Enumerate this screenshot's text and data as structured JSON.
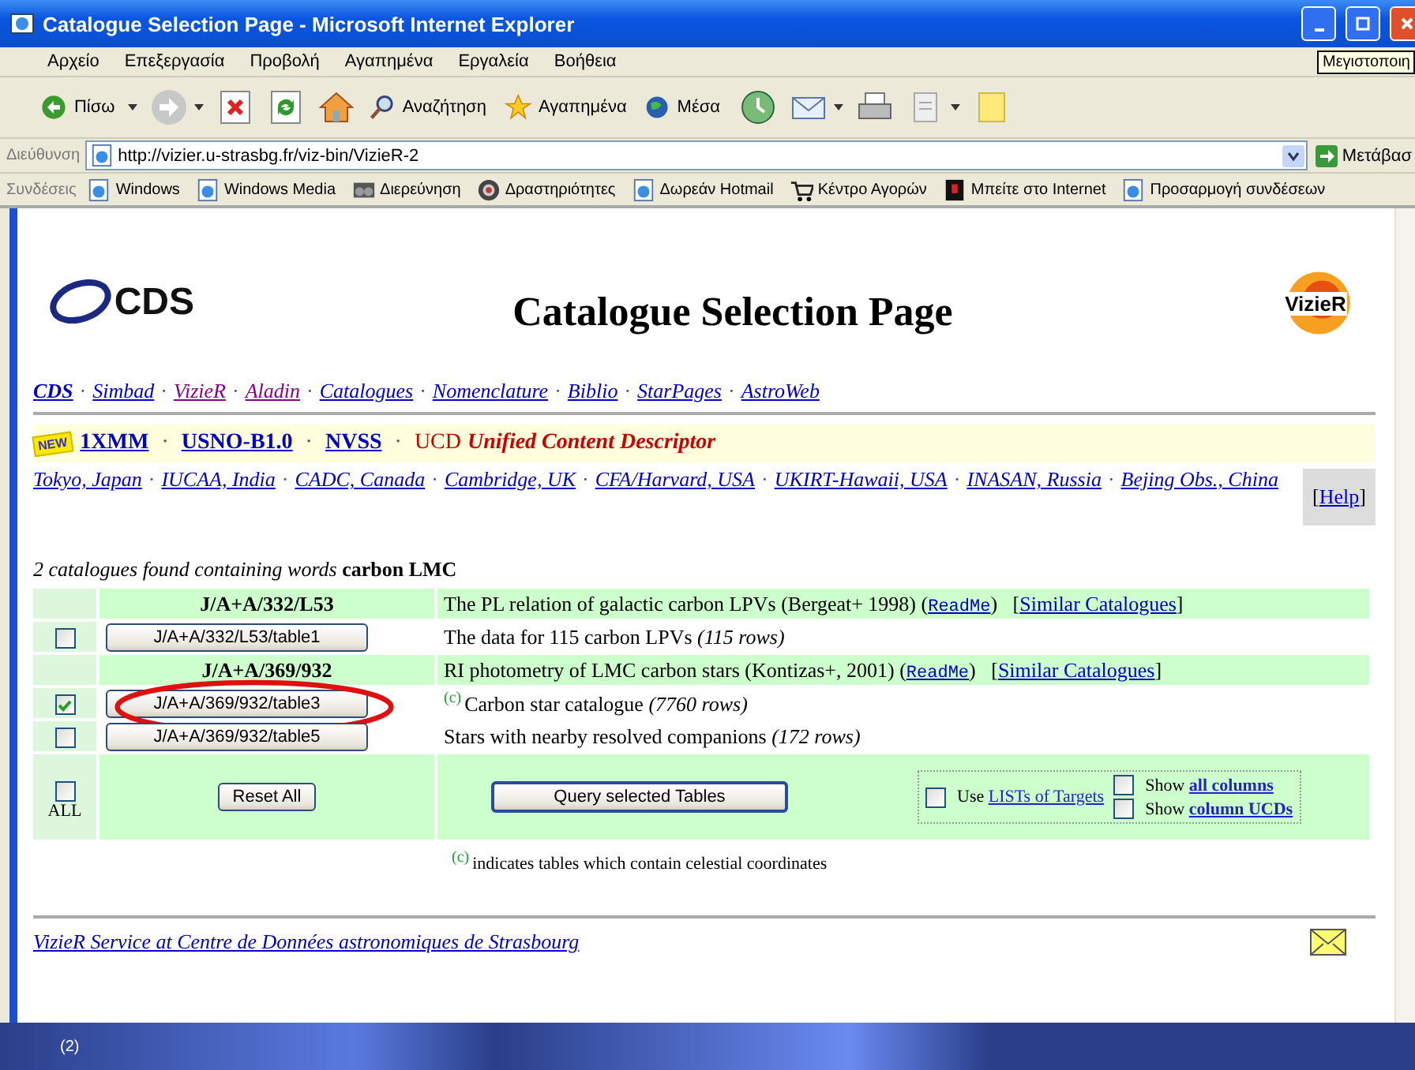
{
  "window": {
    "title": "Catalogue Selection Page - Microsoft Internet Explorer"
  },
  "menu": [
    "Αρχείο",
    "Επεξεργασία",
    "Προβολή",
    "Αγαπημένα",
    "Εργαλεία",
    "Βοήθεια"
  ],
  "tooltip": "Μεγιστοποιη",
  "toolbar": [
    {
      "kind": "back",
      "label": "Πίσω",
      "dropdown": true
    },
    {
      "kind": "forward",
      "dropdown": true
    },
    {
      "kind": "stop",
      "dropdown": false
    },
    {
      "kind": "refresh",
      "dropdown": false
    },
    {
      "kind": "home",
      "dropdown": false
    },
    {
      "kind": "search",
      "label": "Αναζήτηση",
      "dropdown": false
    },
    {
      "kind": "favorites",
      "label": "Αγαπημένα",
      "dropdown": false
    },
    {
      "kind": "media",
      "label": "Μέσα",
      "dropdown": false
    },
    {
      "kind": "history",
      "dropdown": false
    },
    {
      "kind": "mail",
      "dropdown": true
    },
    {
      "kind": "print",
      "dropdown": false
    },
    {
      "kind": "edit",
      "dropdown": true
    },
    {
      "kind": "notes",
      "dropdown": false
    }
  ],
  "address": {
    "label": "Διεύθυνση",
    "value": "http://vizier.u-strasbg.fr/viz-bin/VizieR-2",
    "go": "Μετάβασ"
  },
  "links": {
    "label": "Συνδέσεις",
    "items": [
      {
        "kind": "page",
        "text": "Windows"
      },
      {
        "kind": "page",
        "text": "Windows Media"
      },
      {
        "kind": "explore",
        "text": "Διερεύνηση"
      },
      {
        "kind": "target",
        "text": "Δραστηριότητες"
      },
      {
        "kind": "page",
        "text": "Δωρεάν Hotmail"
      },
      {
        "kind": "cart",
        "text": "Κέντρο Αγορών"
      },
      {
        "kind": "flag",
        "text": "Μπείτε στο Internet"
      },
      {
        "kind": "page",
        "text": "Προσαρμογή συνδέσεων"
      }
    ]
  },
  "page": {
    "cds_logo": "CDS",
    "vizier_logo": "VizieR",
    "title": "Catalogue Selection Page",
    "separator": "·",
    "nav": [
      {
        "text": "CDS",
        "visited": false,
        "bold": true
      },
      {
        "text": "Simbad",
        "visited": false,
        "bold": false
      },
      {
        "text": "VizieR",
        "visited": true,
        "bold": false
      },
      {
        "text": "Aladin",
        "visited": true,
        "bold": false
      },
      {
        "text": "Catalogues",
        "visited": false,
        "bold": false
      },
      {
        "text": "Nomenclature",
        "visited": false,
        "bold": false
      },
      {
        "text": "Biblio",
        "visited": false,
        "bold": false
      },
      {
        "text": "StarPages",
        "visited": false,
        "bold": false
      },
      {
        "text": "AstroWeb",
        "visited": false,
        "bold": false
      }
    ],
    "news": {
      "badge": "NEW",
      "links": [
        "1XMM",
        "USNO-B1.0",
        "NVSS"
      ],
      "ucd": "UCD",
      "ucd_title": "Unified Content Descriptor"
    },
    "mirrors": [
      "Tokyo, Japan",
      "IUCAA, India",
      "CADC, Canada",
      "Cambridge, UK",
      "CFA/Harvard, USA",
      "UKIRT-Hawaii, USA",
      "INASAN, Russia",
      "Bejing Obs., China"
    ],
    "help": {
      "open": "[",
      "link": "Help",
      "close": "]"
    },
    "summary": "2 catalogues found containing words **carbon LMC**",
    "rows": [
      {
        "kind": "catalogue",
        "name": "J/A+A/332/L53",
        "parts": [
          {
            "kind": "text",
            "text": "The PL relation of galactic carbon LPVs (Bergeat+ 1998) ("
          },
          {
            "kind": "readme",
            "text": "ReadMe"
          },
          {
            "kind": "text",
            "text": ")   ["
          },
          {
            "kind": "link",
            "text": "Similar Catalogues"
          },
          {
            "kind": "text",
            "text": "]"
          }
        ]
      },
      {
        "kind": "table",
        "checked": false,
        "circled": false,
        "button": "J/A+A/332/L53/table1",
        "description": "The data for 115 carbon LPVs *(115 rows)*"
      },
      {
        "kind": "catalogue",
        "name": "J/A+A/369/932",
        "parts": [
          {
            "kind": "text",
            "text": "RI photometry of LMC carbon stars (Kontizas+, 2001) ("
          },
          {
            "kind": "readme",
            "text": "ReadMe"
          },
          {
            "kind": "text",
            "text": ")   ["
          },
          {
            "kind": "link",
            "text": "Similar Catalogues"
          },
          {
            "kind": "text",
            "text": "]"
          }
        ]
      },
      {
        "kind": "table",
        "checked": true,
        "circled": true,
        "button": "J/A+A/369/932/table3",
        "coords_mark": "(c)",
        "description": "Carbon star catalogue *(7760 rows)*"
      },
      {
        "kind": "table",
        "checked": false,
        "circled": false,
        "button": "J/A+A/369/932/table5",
        "description": "Stars with nearby resolved companions *(172 rows)*"
      }
    ],
    "all": {
      "checked": false,
      "label": "ALL"
    },
    "reset": "Reset All",
    "query": "Query selected Tables",
    "options": [
      {
        "checked": false,
        "prefix": "Use",
        "link": "LISTs of Targets",
        "bold": false
      },
      {
        "checked": false,
        "prefix": "Show",
        "link": "all columns",
        "bold": true
      },
      {
        "checked": false,
        "prefix": "Show",
        "link": "column UCDs",
        "bold": true
      }
    ],
    "legend": {
      "mark": "(c)",
      "text": "indicates tables which contain celestial coordinates"
    },
    "footer": "VizieR Service at Centre de Données astronomiques de Strasbourg"
  },
  "status": "(2)"
}
